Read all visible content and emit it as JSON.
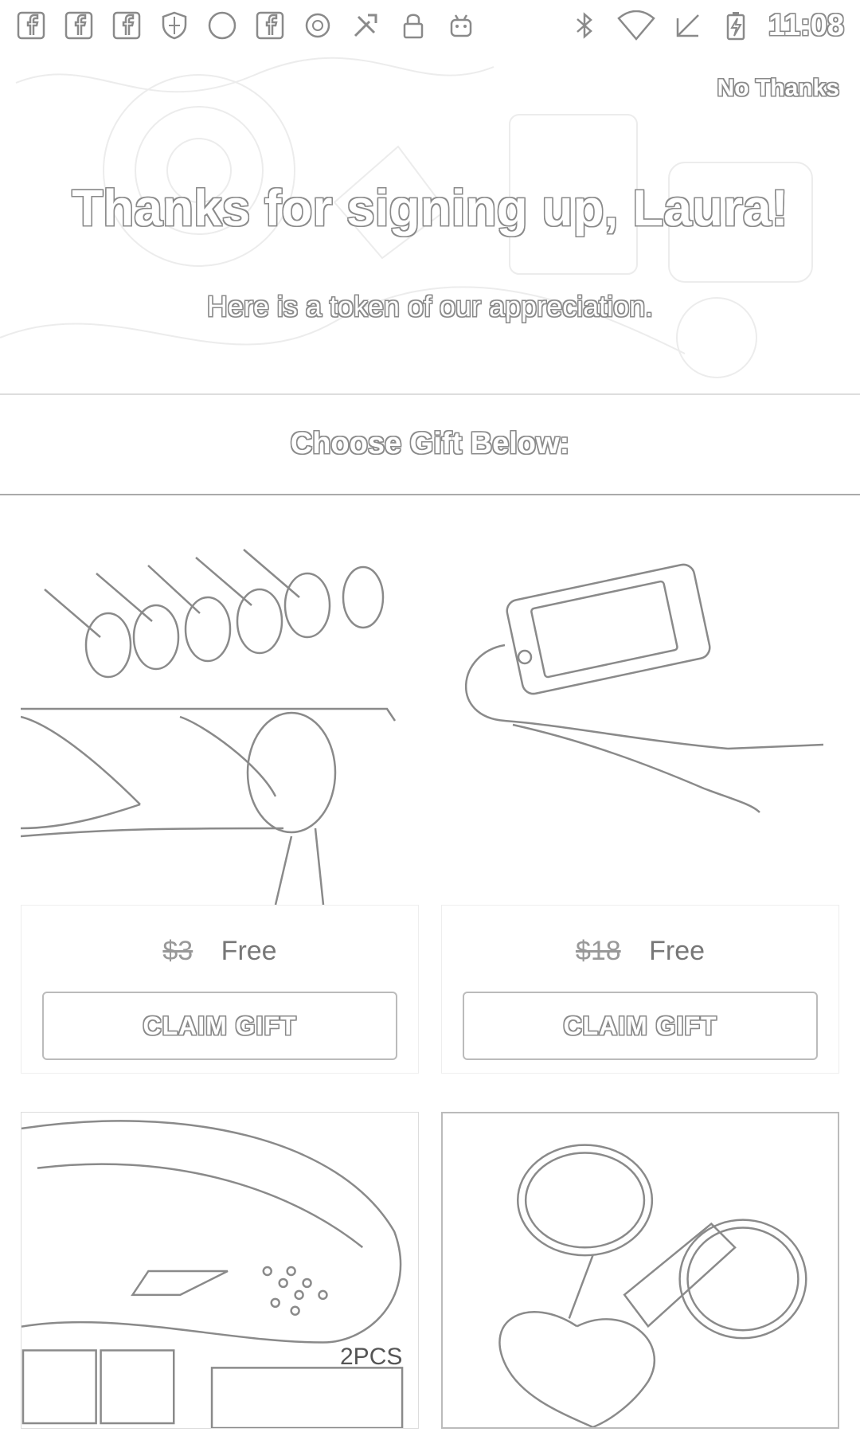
{
  "status_bar": {
    "time": "11:08",
    "left_icons": [
      "facebook-icon",
      "facebook-icon",
      "facebook-icon",
      "shield-icon",
      "circle-icon",
      "facebook-icon",
      "info-icon",
      "tools-icon",
      "lock-icon",
      "android-icon"
    ],
    "right_icons": [
      "bluetooth-icon",
      "wifi-icon",
      "no-sim-icon",
      "battery-charging-icon"
    ]
  },
  "hero": {
    "dismiss_label": "No Thanks",
    "title": "Thanks for signing up, Laura!",
    "subtitle": "Here is a token of our appreciation."
  },
  "gifts_header": "Choose Gift Below:",
  "gifts": [
    {
      "image": "headphones-glasses-image",
      "old_price": "$3",
      "price": "Free",
      "button": "CLAIM GIFT"
    },
    {
      "image": "phone-splitter-cable-image",
      "old_price": "$18",
      "price": "Free",
      "button": "CLAIM GIFT"
    },
    {
      "image": "shoe-insoles-image",
      "overlay_text": "2PCS"
    },
    {
      "image": "heart-keychain-image"
    }
  ],
  "colors": {
    "outline": "#8a8a8a",
    "background": "#ffffff",
    "divider": "#aaaaaa"
  }
}
